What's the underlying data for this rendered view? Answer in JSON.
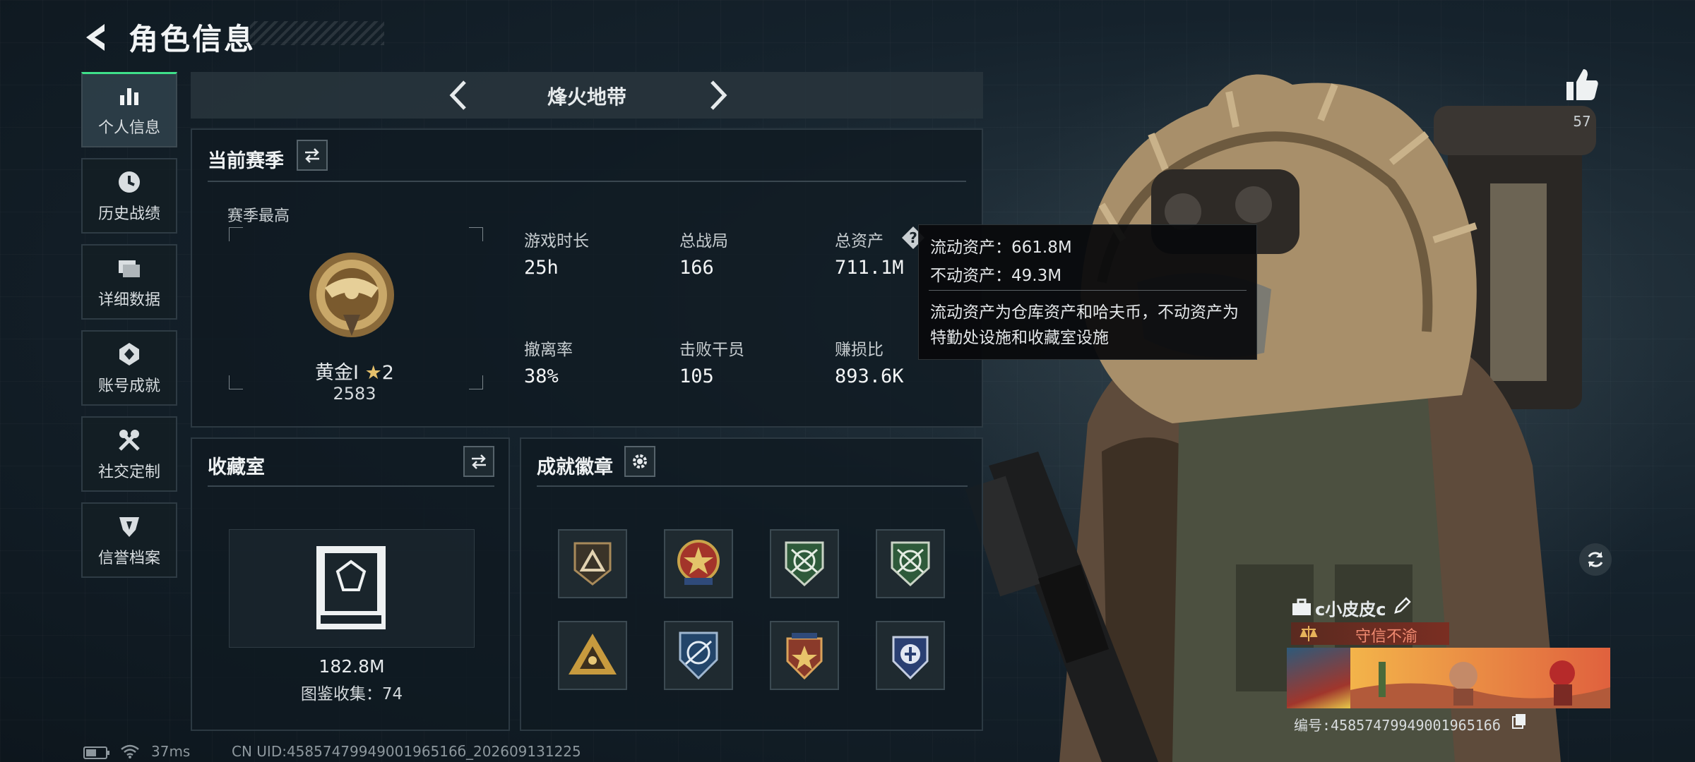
{
  "header": {
    "title": "角色信息"
  },
  "nav": [
    {
      "label": "个人信息",
      "icon": "bar-chart-icon",
      "active": true
    },
    {
      "label": "历史战绩",
      "icon": "history-clock-icon",
      "active": false
    },
    {
      "label": "详细数据",
      "icon": "folders-icon",
      "active": false
    },
    {
      "label": "账号成就",
      "icon": "achievement-icon",
      "active": false
    },
    {
      "label": "社交定制",
      "icon": "wrench-tools-icon",
      "active": false
    },
    {
      "label": "信誉档案",
      "icon": "reputation-shield-icon",
      "active": false
    }
  ],
  "mode": {
    "name": "烽火地带"
  },
  "season": {
    "title": "当前赛季",
    "best_label": "赛季最高",
    "rank_name": "黄金Ⅰ",
    "rank_stars": "2",
    "rank_score": "2583",
    "stats": [
      {
        "label": "游戏时长",
        "value": "25h"
      },
      {
        "label": "总战局",
        "value": "166"
      },
      {
        "label": "总资产",
        "value": "711.1M"
      },
      {
        "label": "撤离率",
        "value": "38%"
      },
      {
        "label": "击败干员",
        "value": "105"
      },
      {
        "label": "赚损比",
        "value": "893.6K"
      }
    ]
  },
  "tooltip": {
    "liquid": "流动资产：661.8M",
    "fixed": "不动资产：49.3M",
    "desc_line1": "流动资产为仓库资产和哈夫币，不动资产为",
    "desc_line2": "特勤处设施和收藏室设施"
  },
  "collection": {
    "title": "收藏室",
    "value": "182.8M",
    "catalog": "图鉴收集：74"
  },
  "achievements": {
    "title": "成就徽章",
    "badges": [
      "triangle-badge-icon",
      "star-emblem-icon",
      "crossed-rifles-green-icon",
      "crossed-rifles-green-2-icon",
      "pyramid-badge-icon",
      "blue-wings-badge-icon",
      "red-star-shield-icon",
      "blue-eagle-badge-icon"
    ]
  },
  "likes": {
    "count": "57"
  },
  "player": {
    "name": "c小皮皮c",
    "reputation": "守信不渝",
    "id_text": "编号:4585747994900196516б"
  },
  "status": {
    "ping": "37ms",
    "uid": "CN UID:4585747994900196516б_202609131225"
  }
}
